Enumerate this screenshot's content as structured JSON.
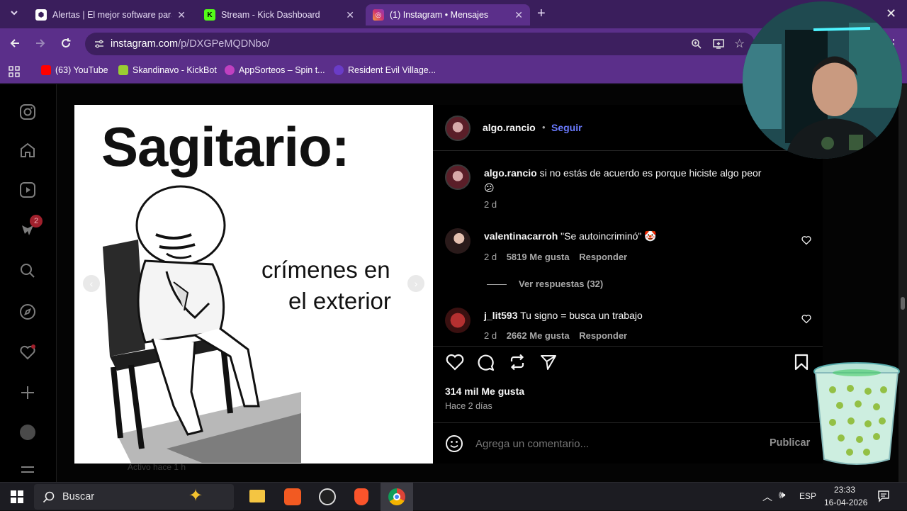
{
  "browser": {
    "tabs": [
      {
        "title": "Alertas | El mejor software para",
        "icon": "alertas-icon",
        "close": "✕"
      },
      {
        "title": "Stream - Kick Dashboard",
        "icon": "kick-icon",
        "close": "✕"
      },
      {
        "title": "(1) Instagram • Mensajes",
        "icon": "instagram-icon",
        "close": "✕"
      }
    ],
    "new_tab": "+",
    "url_domain": "instagram.com",
    "url_path": "/p/DXGPeMQDNbo/",
    "bookmarks": [
      {
        "label": "(63) YouTube",
        "icon": "youtube-icon",
        "color": "#ff0000"
      },
      {
        "label": "Skandinavo - KickBot",
        "icon": "kickbot-icon",
        "color": "#9acd32"
      },
      {
        "label": "AppSorteos – Spin t...",
        "icon": "appsorteos-icon",
        "color": "#c040c0"
      },
      {
        "label": "Resident Evil Village...",
        "icon": "re-icon",
        "color": "#6a3cc7"
      }
    ]
  },
  "sidebar": {
    "notifications_badge": "2",
    "status_text": "Activo hace 1 h"
  },
  "post": {
    "image_title": "Sagitario:",
    "image_caption_line1": "crímenes en",
    "image_caption_line2": "el exterior",
    "author": "algo.rancio",
    "follow_label": "Seguir",
    "separator": "•",
    "caption_user": "algo.rancio",
    "caption_text": "si no estás de acuerdo es porque hiciste algo peor",
    "caption_emoji": "😕",
    "caption_time": "2 d",
    "comments": [
      {
        "user": "valentinacarroh",
        "text": "\"Se autoincriminó\"",
        "emoji": "🤡",
        "time": "2 d",
        "likes": "5819 Me gusta",
        "reply": "Responder"
      },
      {
        "user": "j_lit593",
        "text": "Tu signo = busca un trabajo",
        "emoji": "",
        "time": "2 d",
        "likes": "2662 Me gusta",
        "reply": "Responder"
      }
    ],
    "view_replies": "Ver respuestas (32)",
    "likes_total": "314 mil Me gusta",
    "posted_ago": "Hace 2 días",
    "comment_placeholder": "Agrega un comentario...",
    "publish_label": "Publicar"
  },
  "taskbar": {
    "search_label": "Buscar",
    "language": "ESP",
    "time": "23:33",
    "date": "16-04-2026"
  },
  "colors": {
    "chrome_tabbar": "#3a1e5c",
    "chrome_toolbar": "#5b2f8a",
    "ig_link": "#6b7bff",
    "taskbar": "#1c1c22"
  }
}
